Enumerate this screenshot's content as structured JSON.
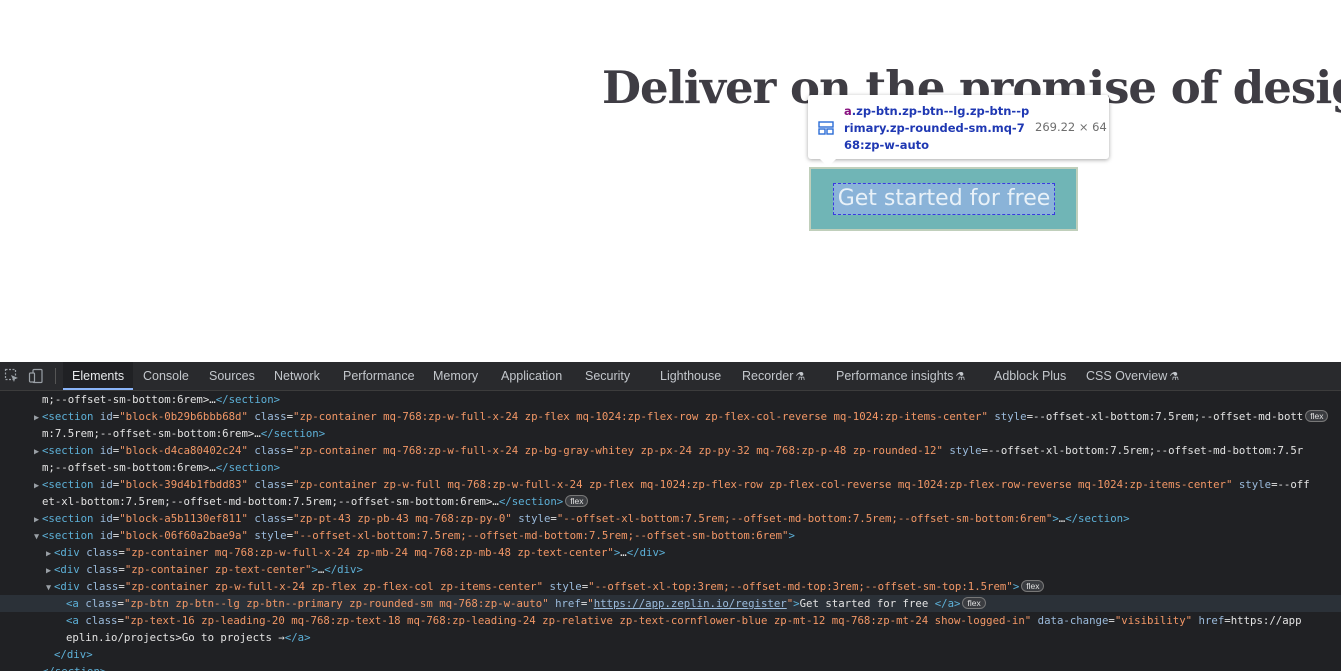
{
  "page": {
    "hero_title": "Deliver on the promise of design",
    "cta_label": "Get started for free"
  },
  "tooltip": {
    "selector_tag": "a",
    "selector_classes": ".zp-btn.zp-btn--lg.zp-btn--primary.zp-rounded-sm.mq-768:zp-w-auto",
    "size": "269.22 × 64"
  },
  "devtools": {
    "tabs": [
      {
        "label": "Elements",
        "active": true
      },
      {
        "label": "Console"
      },
      {
        "label": "Sources"
      },
      {
        "label": "Network"
      },
      {
        "label": "Performance"
      },
      {
        "label": "Memory"
      },
      {
        "label": "Application"
      },
      {
        "label": "Security"
      },
      {
        "label": "Lighthouse"
      },
      {
        "label": "Recorder",
        "experimental": true
      },
      {
        "label": "Performance insights",
        "experimental": true
      },
      {
        "label": "Adblock Plus"
      },
      {
        "label": "CSS Overview",
        "experimental": true
      }
    ],
    "flex_badge": "flex",
    "tree": [
      "m;--offset-sm-bottom:6rem\">…</section>",
      "<section id=\"block-0b29b6bbb68d\" class=\"zp-container mq-768:zp-w-full-x-24 zp-flex mq-1024:zp-flex-row zp-flex-col-reverse mq-1024:zp-items-center\" style=\"--offset-xl-bottom:7.5rem;--offset-md-bott",
      "m:7.5rem;--offset-sm-bottom:6rem\">…</section>",
      "<section id=\"block-d4ca80402c24\" class=\"zp-container mq-768:zp-w-full-x-24 zp-bg-gray-whitey zp-px-24 zp-py-32 mq-768:zp-p-48 zp-rounded-12\" style=\"--offset-xl-bottom:7.5rem;--offset-md-bottom:7.5r",
      "m;--offset-sm-bottom:6rem\">…</section>",
      "<section id=\"block-39d4b1fbdd83\" class=\"zp-container zp-w-full mq-768:zp-w-full-x-24 zp-flex mq-1024:zp-flex-row zp-flex-col-reverse mq-1024:zp-flex-row-reverse mq-1024:zp-items-center\" style=\"--off",
      "et-xl-bottom:7.5rem;--offset-md-bottom:7.5rem;--offset-sm-bottom:6rem\">…</section>",
      "<section id=\"block-a5b1130ef811\" class=\"zp-pt-43 zp-pb-43 mq-768:zp-py-0\" style=\"--offset-xl-bottom:7.5rem;--offset-md-bottom:7.5rem;--offset-sm-bottom:6rem\">…</section>",
      "<section id=\"block-06f60a2bae9a\" style=\"--offset-xl-bottom:7.5rem;--offset-md-bottom:7.5rem;--offset-sm-bottom:6rem\">",
      "<div class=\"zp-container mq-768:zp-w-full-x-24 zp-mb-24 mq-768:zp-mb-48 zp-text-center\">…</div>",
      "<div class=\"zp-container zp-text-center\">…</div>",
      "<div class=\"zp-container zp-w-full-x-24 zp-flex zp-flex-col zp-items-center\" style=\"--offset-xl-top:3rem;--offset-md-top:3rem;--offset-sm-top:1.5rem\">",
      "<a class=\"zp-btn zp-btn--lg zp-btn--primary zp-rounded-sm mq-768:zp-w-auto\" href=\"https://app.zeplin.io/register\">Get started for free </a>",
      "<a class=\"zp-text-16 zp-leading-20 mq-768:zp-text-18 mq-768:zp-leading-24 zp-relative zp-text-cornflower-blue zp-mt-12 mq-768:zp-mt-24 show-logged-in\" data-change=\"visibility\" href=\"https://app",
      "eplin.io/projects\">Go to projects →</a>",
      "</div>",
      "</section>"
    ]
  }
}
